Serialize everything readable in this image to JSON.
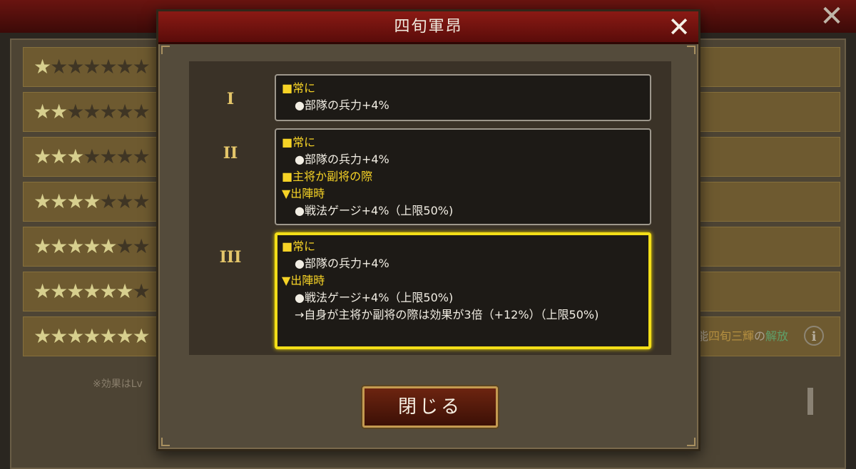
{
  "background": {
    "star_rows": [
      1,
      2,
      3,
      4,
      5,
      6,
      7
    ],
    "max_stars": 7,
    "note": "※効果はLv",
    "skill_line": {
      "prefix": "共係技能",
      "skill_name": "四旬三輝",
      "particle": "の",
      "action": "解放"
    },
    "info_icon": "i",
    "close_icon": "✕"
  },
  "modal": {
    "title": "四旬軍昂",
    "close_icon": "✕",
    "tiers": [
      {
        "numeral": "I",
        "lines": [
          {
            "type": "head",
            "text": "■常に"
          },
          {
            "type": "item",
            "text": "●部隊の兵力+4%"
          }
        ]
      },
      {
        "numeral": "II",
        "lines": [
          {
            "type": "head",
            "text": "■常に"
          },
          {
            "type": "item",
            "text": "●部隊の兵力+4%"
          },
          {
            "type": "head",
            "text": "■主将か副将の際"
          },
          {
            "type": "sub",
            "text": "▼出陣時"
          },
          {
            "type": "item",
            "text": "●戦法ゲージ+4%（上限50%)"
          }
        ]
      },
      {
        "numeral": "III",
        "lines": [
          {
            "type": "head",
            "text": "■常に"
          },
          {
            "type": "item",
            "text": "●部隊の兵力+4%"
          },
          {
            "type": "sub",
            "text": "▼出陣時"
          },
          {
            "type": "item",
            "text": "●戦法ゲージ+4%（上限50%)"
          },
          {
            "type": "wrap",
            "text": "→自身が主将か副将の際は効果が3倍（+12%）（上限50%)"
          }
        ]
      }
    ],
    "close_button": "閉じる"
  }
}
